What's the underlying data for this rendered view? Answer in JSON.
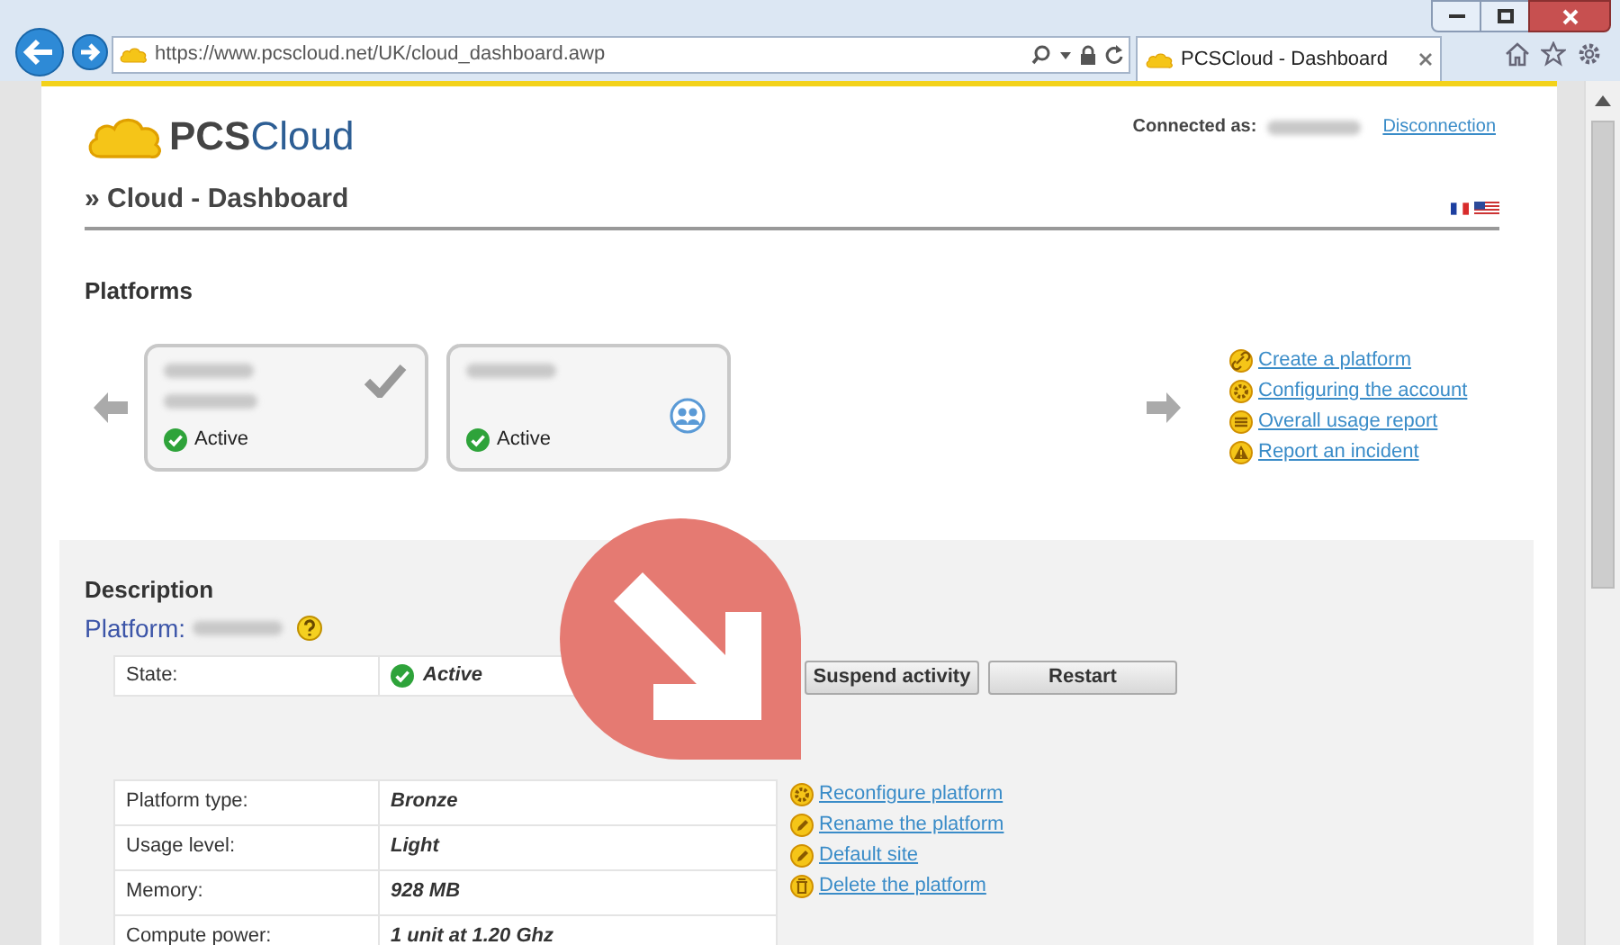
{
  "browser": {
    "url": "https://www.pcscloud.net/UK/cloud_dashboard.awp",
    "tab_title": "PCSCloud - Dashboard"
  },
  "header": {
    "logo": {
      "part_1": "PCS",
      "part_2": "Cloud"
    },
    "connected_label": "Connected as:",
    "disconnect_link": "Disconnection",
    "page_title": "» Cloud - Dashboard"
  },
  "platforms": {
    "heading": "Platforms",
    "cards": [
      {
        "status": "Active",
        "selected": true,
        "shared": false
      },
      {
        "status": "Active",
        "selected": false,
        "shared": true
      }
    ],
    "actions": [
      {
        "kind": "link",
        "label": "Create a platform"
      },
      {
        "kind": "gear",
        "label": "Configuring the account"
      },
      {
        "kind": "report",
        "label": "Overall usage report"
      },
      {
        "kind": "warning",
        "label": "Report an incident"
      }
    ]
  },
  "description": {
    "heading": "Description",
    "platform_label": "Platform:",
    "state_label": "State:",
    "state_value": "Active",
    "buttons": [
      "Suspend activity",
      "Restart"
    ],
    "details": [
      {
        "label": "Platform type:",
        "value": "Bronze"
      },
      {
        "label": "Usage level:",
        "value": "Light"
      },
      {
        "label": "Memory:",
        "value": "928 MB"
      },
      {
        "label": "Compute power:",
        "value": "1 unit at 1.20 Ghz"
      }
    ],
    "actions": [
      {
        "kind": "gear",
        "label": "Reconfigure platform"
      },
      {
        "kind": "edit",
        "label": "Rename the platform"
      },
      {
        "kind": "edit",
        "label": "Default site"
      },
      {
        "kind": "trash",
        "label": "Delete the platform"
      }
    ]
  }
}
